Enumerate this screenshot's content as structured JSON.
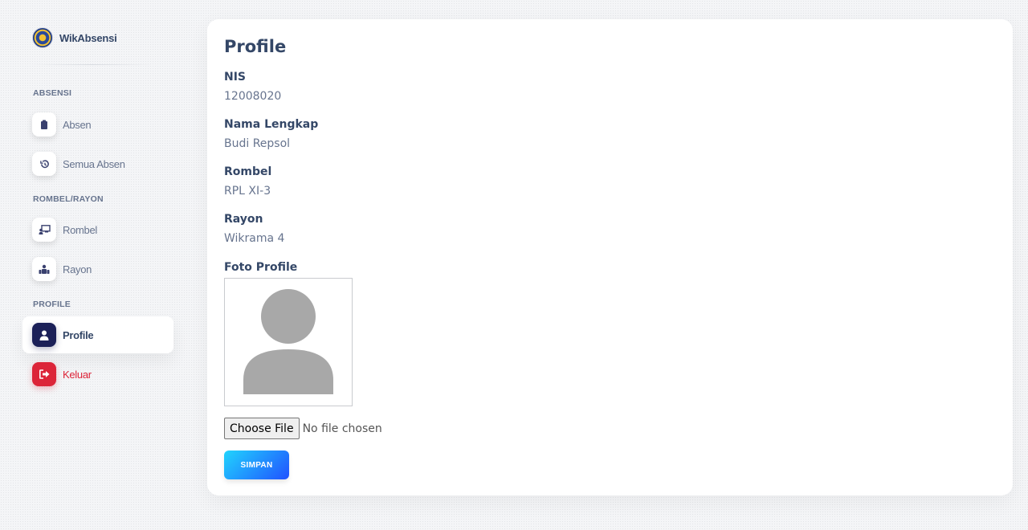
{
  "brand": {
    "name": "WikAbsensi"
  },
  "sidebar": {
    "sections": [
      {
        "title": "ABSENSI"
      },
      {
        "title": "ROMBEL/RAYON"
      },
      {
        "title": "PROFILE"
      }
    ],
    "items": [
      {
        "label": "Absen",
        "icon": "clipboard-icon"
      },
      {
        "label": "Semua Absen",
        "icon": "history-icon"
      },
      {
        "label": "Rombel",
        "icon": "chalkboard-teacher-icon"
      },
      {
        "label": "Rayon",
        "icon": "users-group-icon"
      },
      {
        "label": "Profile",
        "icon": "user-icon",
        "active": true
      },
      {
        "label": "Keluar",
        "icon": "sign-out-icon"
      }
    ]
  },
  "profile": {
    "title": "Profile",
    "fields": [
      {
        "label": "NIS",
        "value": "12008020"
      },
      {
        "label": "Nama Lengkap",
        "value": "Budi Repsol"
      },
      {
        "label": "Rombel",
        "value": "RPL XI-3"
      },
      {
        "label": "Rayon",
        "value": "Wikrama 4"
      }
    ],
    "photo_label": "Foto Profile",
    "file_button": "Choose File",
    "file_status": "No file chosen",
    "save_button": "SIMPAN"
  },
  "colors": {
    "primary_dark": "#1b2058",
    "danger": "#dc2438",
    "gradient_start": "#21d4fd",
    "gradient_end": "#2152ff",
    "text_dark": "#344767",
    "text_muted": "#67748e"
  }
}
